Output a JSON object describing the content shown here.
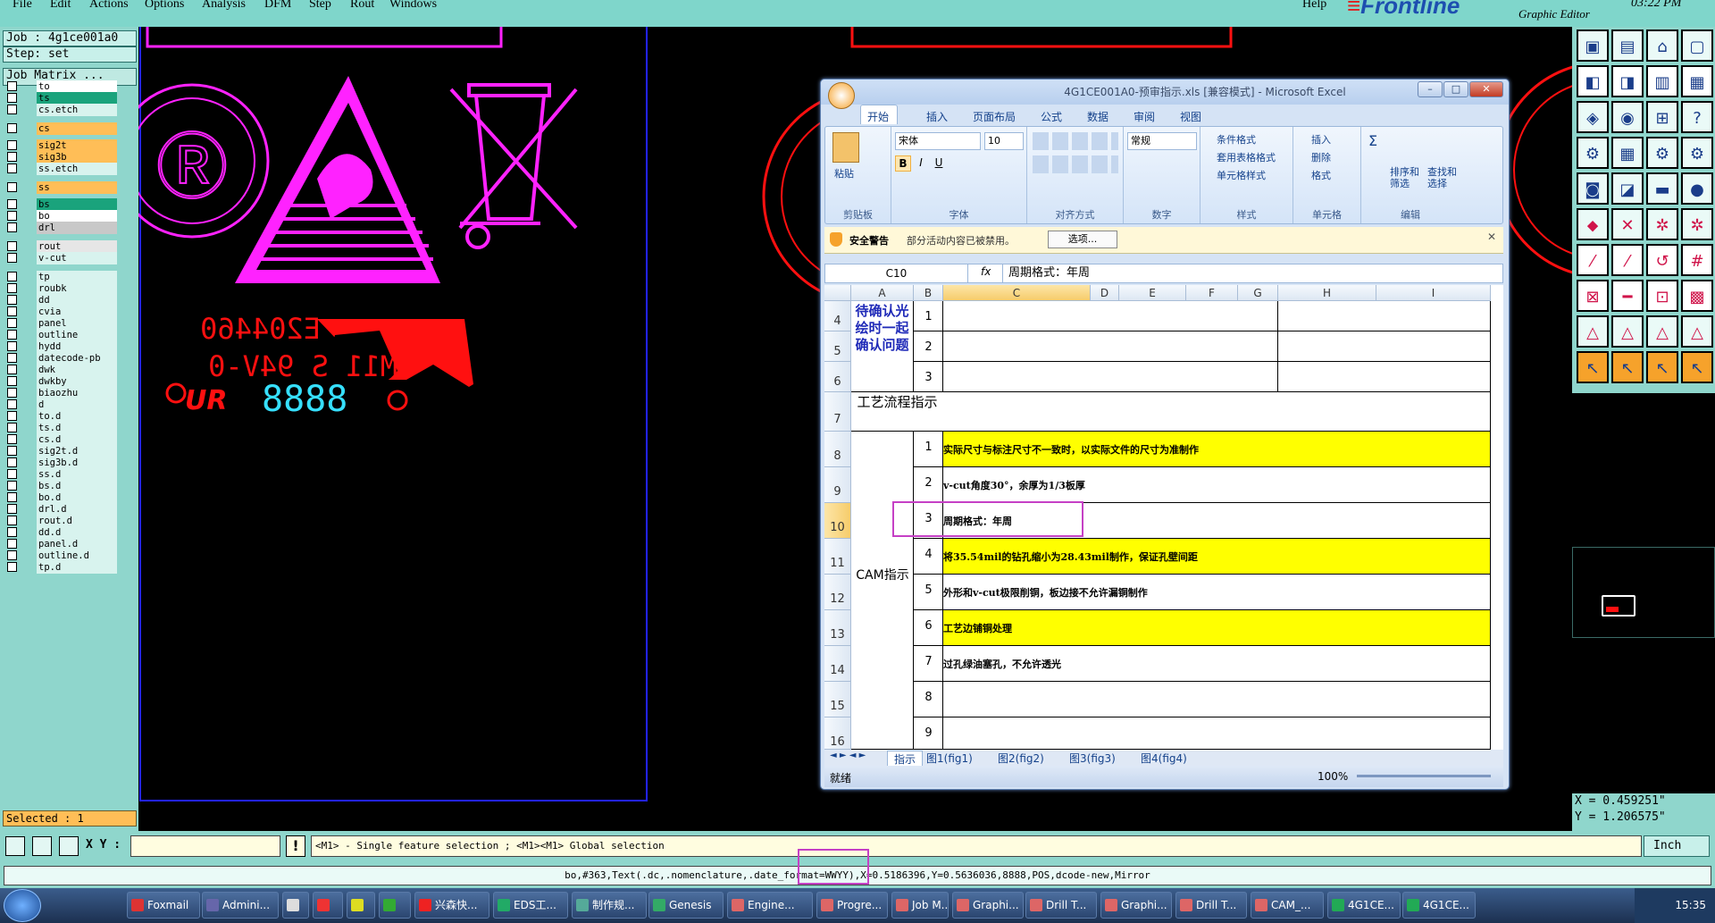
{
  "menu": {
    "items": [
      "File",
      "Edit",
      "Actions",
      "Options",
      "Analysis",
      "DFM",
      "Step",
      "Rout",
      "Windows"
    ],
    "help": "Help",
    "brand": "Frontline",
    "brand_sub": "Graphic Editor",
    "clock": "03:22 PM"
  },
  "left_panel": {
    "job": "Job : 4g1ce001a0",
    "step": "Step: set",
    "job_matrix": "Job Matrix ...",
    "selected": "Selected : 1",
    "layers": [
      {
        "name": "to",
        "color": "#ffffff"
      },
      {
        "name": "ts",
        "color": "#1aa37c"
      },
      {
        "name": "cs.etch",
        "color": "#d8f3ee"
      },
      {
        "name": "cs",
        "color": "#ffbe57"
      },
      {
        "name": "sig2t",
        "color": "#ffbe57"
      },
      {
        "name": "sig3b",
        "color": "#ffbe57"
      },
      {
        "name": "ss.etch",
        "color": "#d8f3ee"
      },
      {
        "name": "ss",
        "color": "#ffbe57"
      },
      {
        "name": "bs",
        "color": "#1aa37c"
      },
      {
        "name": "bo",
        "color": "#ffffff"
      },
      {
        "name": "drl",
        "color": "#c8c8c8"
      },
      {
        "name": "rout",
        "color": "#e6e6e6"
      },
      {
        "name": "v-cut",
        "color": "#d8f3ee"
      },
      {
        "name": "tp",
        "color": "#d8f3ee"
      },
      {
        "name": "roubk",
        "color": "#d8f3ee"
      },
      {
        "name": "dd",
        "color": "#d8f3ee"
      },
      {
        "name": "cvia",
        "color": "#d8f3ee"
      },
      {
        "name": "panel",
        "color": "#d8f3ee"
      },
      {
        "name": "outline",
        "color": "#d8f3ee"
      },
      {
        "name": "hydd",
        "color": "#d8f3ee"
      },
      {
        "name": "datecode-pb",
        "color": "#d8f3ee"
      },
      {
        "name": "dwk",
        "color": "#d8f3ee"
      },
      {
        "name": "dwkby",
        "color": "#d8f3ee"
      },
      {
        "name": "biaozhu",
        "color": "#d8f3ee"
      },
      {
        "name": "d",
        "color": "#d8f3ee"
      },
      {
        "name": "to.d",
        "color": "#d8f3ee"
      },
      {
        "name": "ts.d",
        "color": "#d8f3ee"
      },
      {
        "name": "cs.d",
        "color": "#d8f3ee"
      },
      {
        "name": "sig2t.d",
        "color": "#d8f3ee"
      },
      {
        "name": "sig3b.d",
        "color": "#d8f3ee"
      },
      {
        "name": "ss.d",
        "color": "#d8f3ee"
      },
      {
        "name": "bs.d",
        "color": "#d8f3ee"
      },
      {
        "name": "bo.d",
        "color": "#d8f3ee"
      },
      {
        "name": "drl.d",
        "color": "#d8f3ee"
      },
      {
        "name": "rout.d",
        "color": "#d8f3ee"
      },
      {
        "name": "dd.d",
        "color": "#d8f3ee"
      },
      {
        "name": "panel.d",
        "color": "#d8f3ee"
      },
      {
        "name": "outline.d",
        "color": "#d8f3ee"
      },
      {
        "name": "tp.d",
        "color": "#d8f3ee"
      }
    ]
  },
  "canvas": {
    "marking_line1": "E204460",
    "marking_line2": "M11 S 94V-0",
    "date_code": "8888"
  },
  "status": {
    "xy_label": "X Y :",
    "xy_value": "",
    "hint": "<M1> - Single feature selection ; <M1><M1> Global selection",
    "units": "Inch",
    "feature_info": "bo,#363,Text(.dc,.nomenclature,.date_format=WWYY),X=0.5186396,Y=0.5636036,8888,POS,dcode-new,Mirror"
  },
  "coords": {
    "x": "X = 0.459251\"",
    "y": "Y = 1.206575\""
  },
  "excel": {
    "title": "4G1CE001A0-预审指示.xls [兼容模式] - Microsoft Excel",
    "tabs": [
      "开始",
      "插入",
      "页面布局",
      "公式",
      "数据",
      "审阅",
      "视图"
    ],
    "font_name": "宋体",
    "font_size": "10",
    "number_format": "常规",
    "groups": [
      "剪贴板",
      "字体",
      "对齐方式",
      "数字",
      "样式",
      "单元格",
      "编辑"
    ],
    "clipboard": {
      "paste": "粘贴"
    },
    "styles": [
      "条件格式",
      "套用表格格式",
      "单元格样式"
    ],
    "cells_cmds": [
      "插入",
      "删除",
      "格式"
    ],
    "editing": [
      "排序和筛选",
      "查找和选择"
    ],
    "security_label": "安全警告",
    "security_msg": "部分活动内容已被禁用。",
    "options_btn": "选项...",
    "name_box": "C10",
    "fx": "fx",
    "formula": "周期格式：年周",
    "columns": [
      "A",
      "B",
      "C",
      "D",
      "E",
      "F",
      "G",
      "H",
      "I"
    ],
    "row_headers": [
      "4",
      "5",
      "6",
      "7",
      "8",
      "9",
      "10",
      "11",
      "12",
      "13",
      "14",
      "15",
      "16"
    ],
    "pending_label": "待确认光绘时一起确认问题",
    "process_label": "工艺流程指示",
    "cam_label": "CAM指示",
    "pending_nums": [
      "1",
      "2",
      "3"
    ],
    "cam_rows": [
      {
        "n": "1",
        "text": "实际尺寸与标注尺寸不一致时，以实际文件的尺寸为准制作",
        "yellow": true
      },
      {
        "n": "2",
        "text": "v-cut角度30°，余厚为1/3板厚",
        "yellow": false
      },
      {
        "n": "3",
        "text": "周期格式：年周",
        "yellow": false
      },
      {
        "n": "4",
        "text": "将35.54mil的钻孔缩小为28.43mil制作，保证孔壁间距",
        "yellow": true
      },
      {
        "n": "5",
        "text": "外形和v-cut极限削铜，板边接不允许漏铜制作",
        "yellow": false
      },
      {
        "n": "6",
        "text": "工艺边铺铜处理",
        "yellow": true
      },
      {
        "n": "7",
        "text": "过孔绿油塞孔，不允许透光",
        "yellow": false
      },
      {
        "n": "8",
        "text": "",
        "yellow": false
      },
      {
        "n": "9",
        "text": "",
        "yellow": false
      }
    ],
    "sheet_tabs": [
      "指示",
      "图1(fig1)",
      "图2(fig2)",
      "图3(fig3)",
      "图4(fig4)"
    ],
    "status_ready": "就绪",
    "zoom": "100%"
  },
  "taskbar": {
    "items": [
      "Foxmail",
      "Admini...",
      "",
      "",
      "",
      "",
      "兴森快...",
      "EDS工...",
      "制作规...",
      "Genesis",
      "Engine...",
      "Progre...",
      "Job M...",
      "Graphi...",
      "Drill T...",
      "Graphi...",
      "Drill T...",
      "CAM_...",
      "4G1CE...",
      "4G1CE..."
    ],
    "clock": "15:35"
  },
  "colors": {
    "teal_panel": "#8fd6cc",
    "canvas_bg": "#000000",
    "magenta": "#ff22ff",
    "red": "#ff1010",
    "blue": "#2222ff",
    "cyan_digits": "#36e0ff",
    "excel_yellow": "#ffff00",
    "highlight_box": "#c540c5"
  }
}
